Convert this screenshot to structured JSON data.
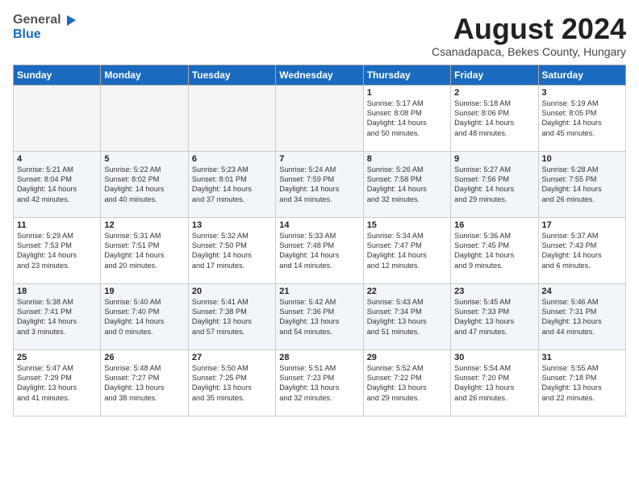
{
  "header": {
    "logo_general": "General",
    "logo_blue": "Blue",
    "month_year": "August 2024",
    "location": "Csanadapaca, Bekes County, Hungary"
  },
  "days_of_week": [
    "Sunday",
    "Monday",
    "Tuesday",
    "Wednesday",
    "Thursday",
    "Friday",
    "Saturday"
  ],
  "weeks": [
    [
      {
        "day": "",
        "info": ""
      },
      {
        "day": "",
        "info": ""
      },
      {
        "day": "",
        "info": ""
      },
      {
        "day": "",
        "info": ""
      },
      {
        "day": "1",
        "info": "Sunrise: 5:17 AM\nSunset: 8:08 PM\nDaylight: 14 hours\nand 50 minutes."
      },
      {
        "day": "2",
        "info": "Sunrise: 5:18 AM\nSunset: 8:06 PM\nDaylight: 14 hours\nand 48 minutes."
      },
      {
        "day": "3",
        "info": "Sunrise: 5:19 AM\nSunset: 8:05 PM\nDaylight: 14 hours\nand 45 minutes."
      }
    ],
    [
      {
        "day": "4",
        "info": "Sunrise: 5:21 AM\nSunset: 8:04 PM\nDaylight: 14 hours\nand 42 minutes."
      },
      {
        "day": "5",
        "info": "Sunrise: 5:22 AM\nSunset: 8:02 PM\nDaylight: 14 hours\nand 40 minutes."
      },
      {
        "day": "6",
        "info": "Sunrise: 5:23 AM\nSunset: 8:01 PM\nDaylight: 14 hours\nand 37 minutes."
      },
      {
        "day": "7",
        "info": "Sunrise: 5:24 AM\nSunset: 7:59 PM\nDaylight: 14 hours\nand 34 minutes."
      },
      {
        "day": "8",
        "info": "Sunrise: 5:26 AM\nSunset: 7:58 PM\nDaylight: 14 hours\nand 32 minutes."
      },
      {
        "day": "9",
        "info": "Sunrise: 5:27 AM\nSunset: 7:56 PM\nDaylight: 14 hours\nand 29 minutes."
      },
      {
        "day": "10",
        "info": "Sunrise: 5:28 AM\nSunset: 7:55 PM\nDaylight: 14 hours\nand 26 minutes."
      }
    ],
    [
      {
        "day": "11",
        "info": "Sunrise: 5:29 AM\nSunset: 7:53 PM\nDaylight: 14 hours\nand 23 minutes."
      },
      {
        "day": "12",
        "info": "Sunrise: 5:31 AM\nSunset: 7:51 PM\nDaylight: 14 hours\nand 20 minutes."
      },
      {
        "day": "13",
        "info": "Sunrise: 5:32 AM\nSunset: 7:50 PM\nDaylight: 14 hours\nand 17 minutes."
      },
      {
        "day": "14",
        "info": "Sunrise: 5:33 AM\nSunset: 7:48 PM\nDaylight: 14 hours\nand 14 minutes."
      },
      {
        "day": "15",
        "info": "Sunrise: 5:34 AM\nSunset: 7:47 PM\nDaylight: 14 hours\nand 12 minutes."
      },
      {
        "day": "16",
        "info": "Sunrise: 5:36 AM\nSunset: 7:45 PM\nDaylight: 14 hours\nand 9 minutes."
      },
      {
        "day": "17",
        "info": "Sunrise: 5:37 AM\nSunset: 7:43 PM\nDaylight: 14 hours\nand 6 minutes."
      }
    ],
    [
      {
        "day": "18",
        "info": "Sunrise: 5:38 AM\nSunset: 7:41 PM\nDaylight: 14 hours\nand 3 minutes."
      },
      {
        "day": "19",
        "info": "Sunrise: 5:40 AM\nSunset: 7:40 PM\nDaylight: 14 hours\nand 0 minutes."
      },
      {
        "day": "20",
        "info": "Sunrise: 5:41 AM\nSunset: 7:38 PM\nDaylight: 13 hours\nand 57 minutes."
      },
      {
        "day": "21",
        "info": "Sunrise: 5:42 AM\nSunset: 7:36 PM\nDaylight: 13 hours\nand 54 minutes."
      },
      {
        "day": "22",
        "info": "Sunrise: 5:43 AM\nSunset: 7:34 PM\nDaylight: 13 hours\nand 51 minutes."
      },
      {
        "day": "23",
        "info": "Sunrise: 5:45 AM\nSunset: 7:33 PM\nDaylight: 13 hours\nand 47 minutes."
      },
      {
        "day": "24",
        "info": "Sunrise: 5:46 AM\nSunset: 7:31 PM\nDaylight: 13 hours\nand 44 minutes."
      }
    ],
    [
      {
        "day": "25",
        "info": "Sunrise: 5:47 AM\nSunset: 7:29 PM\nDaylight: 13 hours\nand 41 minutes."
      },
      {
        "day": "26",
        "info": "Sunrise: 5:48 AM\nSunset: 7:27 PM\nDaylight: 13 hours\nand 38 minutes."
      },
      {
        "day": "27",
        "info": "Sunrise: 5:50 AM\nSunset: 7:25 PM\nDaylight: 13 hours\nand 35 minutes."
      },
      {
        "day": "28",
        "info": "Sunrise: 5:51 AM\nSunset: 7:23 PM\nDaylight: 13 hours\nand 32 minutes."
      },
      {
        "day": "29",
        "info": "Sunrise: 5:52 AM\nSunset: 7:22 PM\nDaylight: 13 hours\nand 29 minutes."
      },
      {
        "day": "30",
        "info": "Sunrise: 5:54 AM\nSunset: 7:20 PM\nDaylight: 13 hours\nand 26 minutes."
      },
      {
        "day": "31",
        "info": "Sunrise: 5:55 AM\nSunset: 7:18 PM\nDaylight: 13 hours\nand 22 minutes."
      }
    ]
  ]
}
